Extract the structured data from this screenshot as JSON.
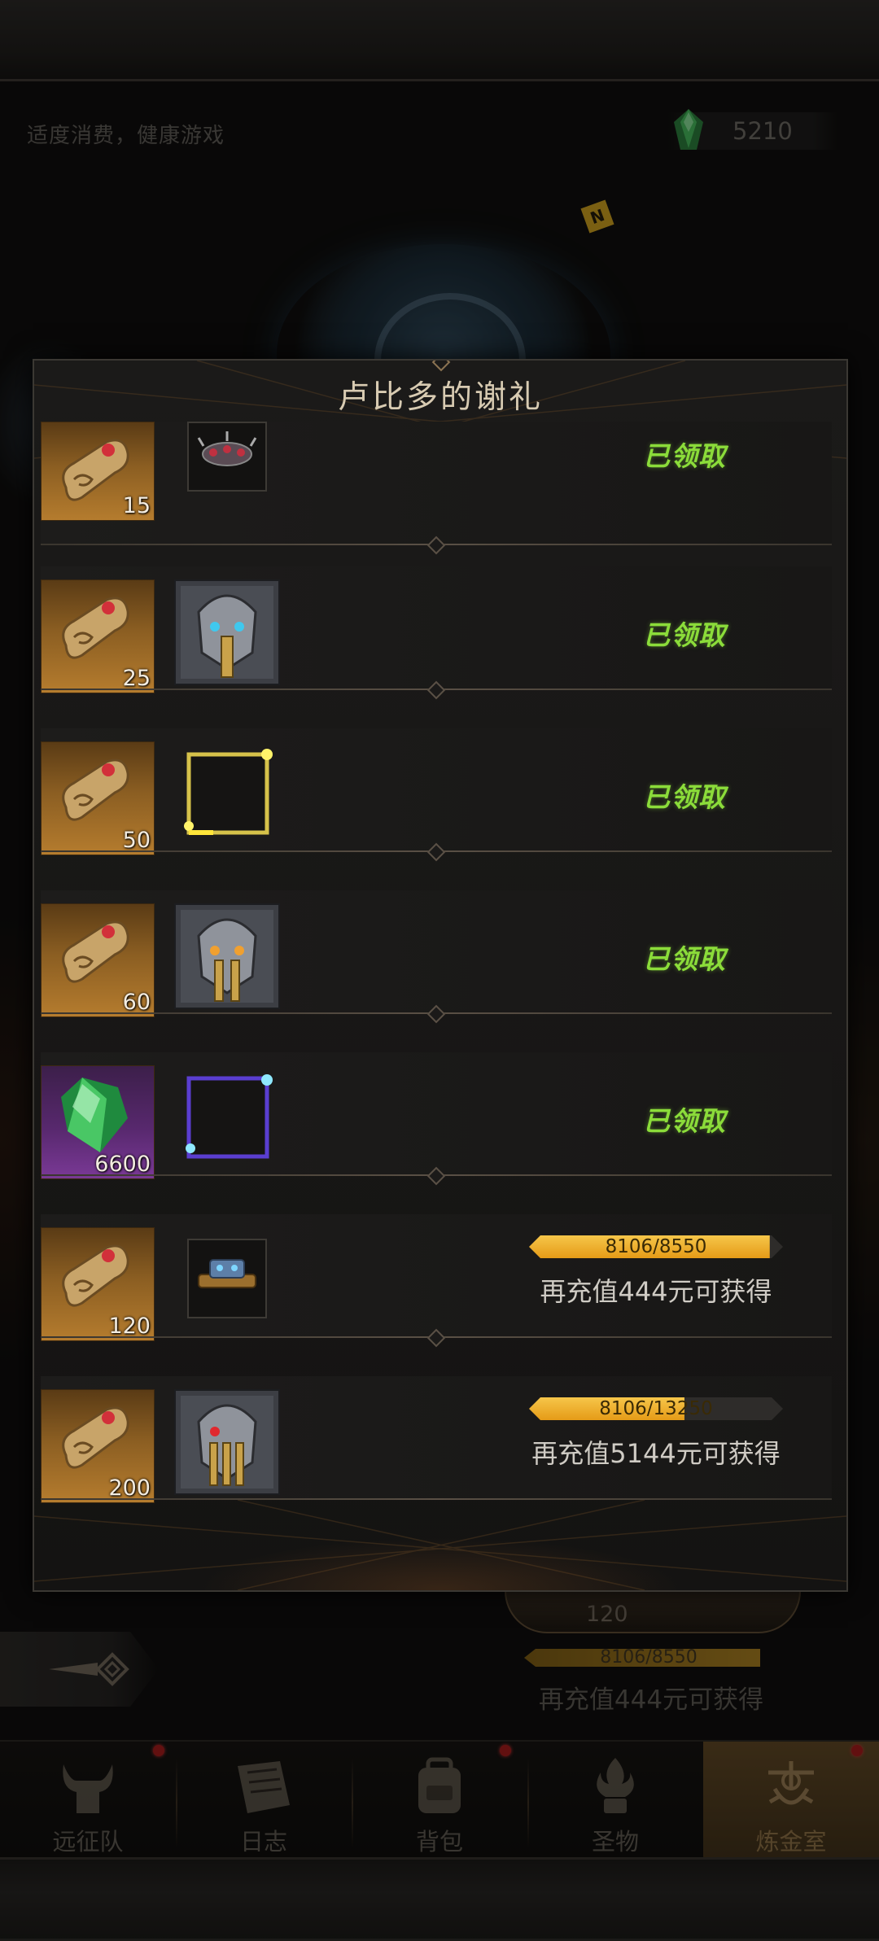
{
  "header": {
    "health_notice": "适度消费，健康游戏",
    "currency_value": "5210",
    "badge_letter": "N"
  },
  "background": {
    "scroll_count": "120",
    "progress_text": "8106/8550",
    "progress_fraction": 0.948,
    "recharge_text": "再充值444元可获得"
  },
  "modal": {
    "title": "卢比多的谢礼",
    "rows": [
      {
        "scroll_count": "15",
        "reward_icon": "spiked-bracelet-icon",
        "status": "已领取"
      },
      {
        "scroll_count": "25",
        "reward_icon": "helmet-tier-1-icon",
        "status": "已领取"
      },
      {
        "scroll_count": "50",
        "reward_icon": "gold-frame-icon",
        "status": "已领取"
      },
      {
        "scroll_count": "60",
        "reward_icon": "helmet-tier-2-icon",
        "status": "已领取"
      },
      {
        "scroll_count": "6600",
        "reward_icon": "purple-frame-icon",
        "status": "已领取",
        "item": "green-gem-icon"
      },
      {
        "scroll_count": "120",
        "reward_icon": "crown-belt-icon",
        "progress_text": "8106/8550",
        "progress_fraction": 0.948,
        "recharge_text": "再充值444元可获得"
      },
      {
        "scroll_count": "200",
        "reward_icon": "helmet-tier-3-icon",
        "progress_text": "8106/13250",
        "progress_fraction": 0.612,
        "recharge_text": "再充值5144元可获得"
      }
    ]
  },
  "nav": {
    "items": [
      {
        "label": "远征队",
        "icon": "viking-helmet-icon",
        "dot": true
      },
      {
        "label": "日志",
        "icon": "journal-icon",
        "dot": false
      },
      {
        "label": "背包",
        "icon": "backpack-icon",
        "dot": true
      },
      {
        "label": "圣物",
        "icon": "relic-flame-icon",
        "dot": false
      },
      {
        "label": "炼金室",
        "icon": "alchemy-icon",
        "dot": true,
        "active": true
      }
    ]
  },
  "colors": {
    "claimed_green": "#8bdc3a",
    "progress_gold": "#f0b430",
    "panel_border": "#3b3833"
  }
}
